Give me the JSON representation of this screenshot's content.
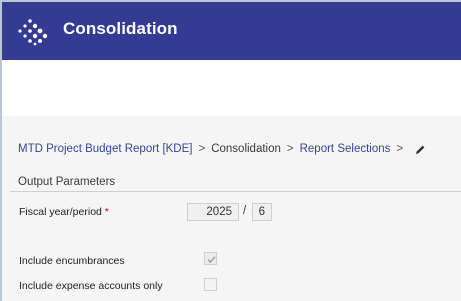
{
  "header": {
    "title": "Consolidation",
    "background_color": "#333b92",
    "logo_icon": "diamond-dots-icon"
  },
  "breadcrumb": {
    "items": [
      "MTD Project Budget Report [KDE]",
      "Consolidation",
      "Report Selections"
    ],
    "separator": ">",
    "edit_icon": "pencil-icon",
    "link_color": "#33479b"
  },
  "output_parameters": {
    "title": "Output Parameters",
    "fiscal_year_period": {
      "label": "Fiscal year/period",
      "required_mark": "*",
      "year": "2025",
      "separator": "/",
      "period": "6"
    },
    "include_encumbrances": {
      "label": "Include encumbrances",
      "checked": true
    },
    "include_expense_accounts_only": {
      "label": "Include expense accounts only",
      "checked": false
    }
  }
}
